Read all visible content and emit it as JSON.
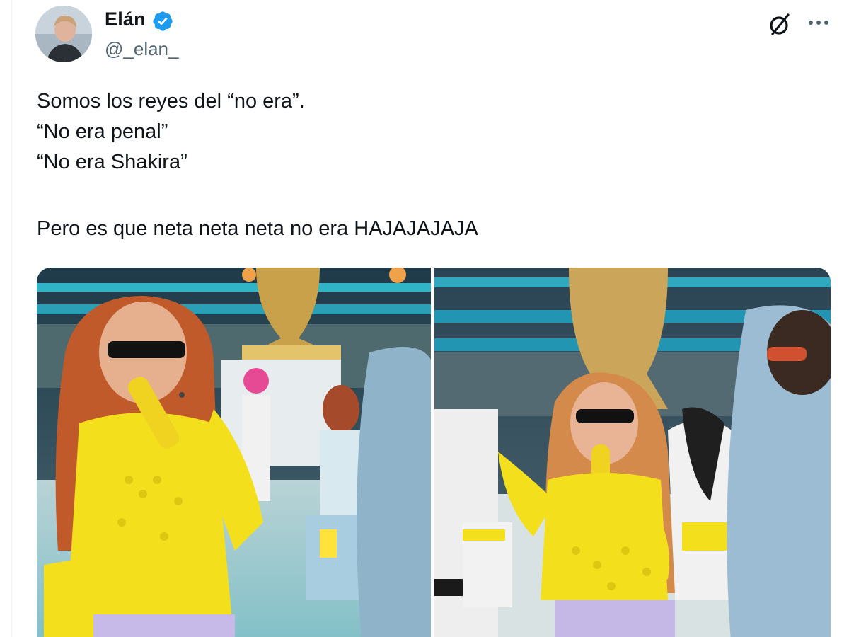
{
  "author": {
    "name": "Elán",
    "handle": "@_elan_",
    "verified": true,
    "verified_color": "#1d9bf0"
  },
  "header_actions": {
    "grok_icon": "grok-slash-icon",
    "more_icon": "more-horizontal-icon"
  },
  "tweet": {
    "lines": [
      "Somos los reyes del “no era”.",
      "“No era penal”",
      "“No era Shakira”",
      "",
      "Pero es que neta neta neta no era HAJAJAJAJA"
    ]
  },
  "media": {
    "count": 2,
    "images": [
      "stadium-performance-photo-left",
      "stadium-performance-photo-right"
    ]
  },
  "colors": {
    "text": "#0f1419",
    "secondary": "#536471",
    "accent": "#1d9bf0"
  }
}
